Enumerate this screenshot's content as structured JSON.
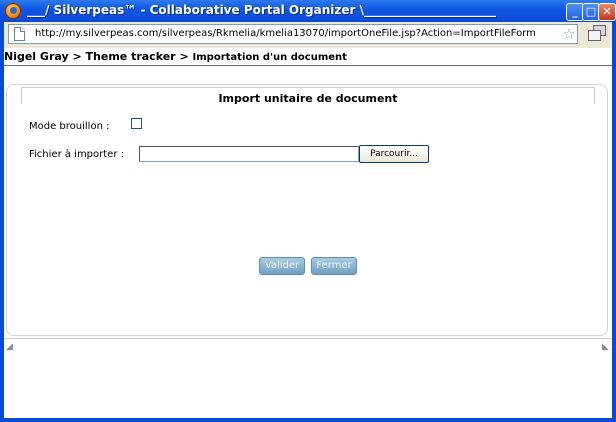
{
  "window": {
    "title": "___/ Silverpeas™ - Collaborative Portal Organizer \\______________________",
    "min_glyph": "_",
    "max_glyph": "□",
    "close_glyph": "✕"
  },
  "address_bar": {
    "url": "http://my.silverpeas.com/silverpeas/Rkmelia/kmelia13070/importOneFile.jsp?Action=ImportFileForm&Topic",
    "star_glyph": "☆"
  },
  "breadcrumb": {
    "items": [
      "Nigel Gray",
      "Theme tracker"
    ],
    "separator": ">",
    "current": "Importation d'un document"
  },
  "form": {
    "title": "Import unitaire de document",
    "draft_label": "Mode brouillon :",
    "file_label": "Fichier à importer :",
    "file_value": "",
    "browse_label": "Parcourir...",
    "validate_label": "Valider",
    "close_label": "Fermer"
  },
  "icons": {
    "app_icon": "firefox-icon",
    "page_icon": "page-icon",
    "bookmark_icon": "star-icon",
    "window_restore_icon": "restore-icon",
    "corner_left": "corner-arrow-icon",
    "corner_right": "corner-arrow-icon"
  },
  "colors": {
    "window_blue": "#0a4bd6",
    "action_button": "#7fa9cc",
    "panel_border": "#d4d4d4"
  }
}
